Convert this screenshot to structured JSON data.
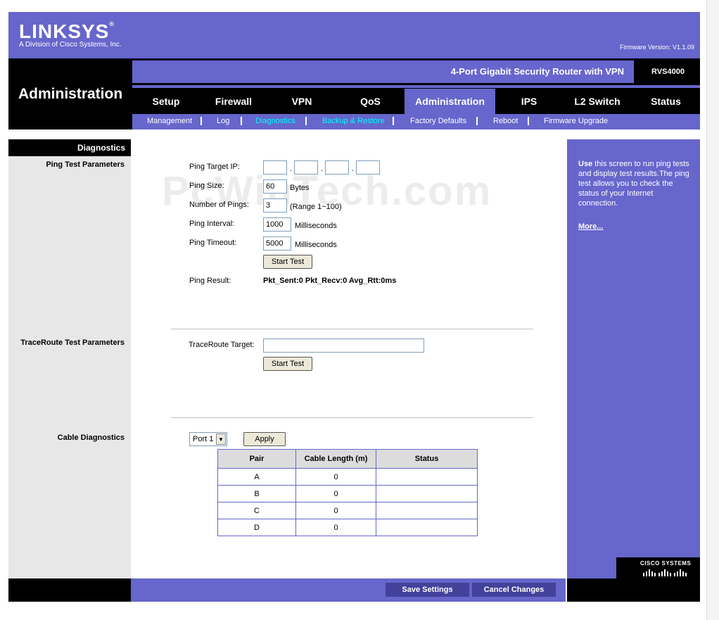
{
  "brand": {
    "logo": "LINKSYS",
    "logo_mark": "®",
    "subtitle": "A Division of Cisco Systems, Inc.",
    "firmware": "Firmware Version: V1.1.09",
    "product": "4-Port Gigabit Security Router with VPN",
    "model": "RVS4000",
    "cisco": "CISCO SYSTEMS"
  },
  "section_title": "Administration",
  "tabs": [
    {
      "label": "Setup"
    },
    {
      "label": "Firewall"
    },
    {
      "label": "VPN"
    },
    {
      "label": "QoS"
    },
    {
      "label": "Administration"
    },
    {
      "label": "IPS"
    },
    {
      "label": "L2 Switch"
    },
    {
      "label": "Status"
    }
  ],
  "subtabs": [
    {
      "label": "Management"
    },
    {
      "label": "Log"
    },
    {
      "label": "Diagnostics"
    },
    {
      "label": "Backup & Restore"
    },
    {
      "label": "Factory Defaults"
    },
    {
      "label": "Reboot"
    },
    {
      "label": "Firmware Upgrade"
    }
  ],
  "left": {
    "title": "Diagnostics",
    "ping_params": "Ping Test Parameters",
    "trace_params": "TraceRoute Test Parameters",
    "cable_diag": "Cable Diagnostics"
  },
  "ping": {
    "target_label": "Ping Target IP:",
    "octets": [
      "",
      "",
      "",
      ""
    ],
    "size_label": "Ping Size:",
    "size_value": "60",
    "size_unit": "Bytes",
    "count_label": "Number of Pings:",
    "count_value": "3",
    "count_range": "(Range 1~100)",
    "interval_label": "Ping Interval:",
    "interval_value": "1000",
    "interval_unit": "Milliseconds",
    "timeout_label": "Ping Timeout:",
    "timeout_value": "5000",
    "timeout_unit": "Milliseconds",
    "start_button": "Start Test",
    "result_label": "Ping Result:",
    "result_value": "Pkt_Sent:0 Pkt_Recv:0 Avg_Rtt:0ms"
  },
  "trace": {
    "target_label": "TraceRoute Target:",
    "target_value": "",
    "start_button": "Start Test"
  },
  "cable": {
    "port_selected": "Port 1",
    "apply_button": "Apply",
    "headers": [
      "Pair",
      "Cable Length (m)",
      "Status"
    ],
    "rows": [
      {
        "pair": "A",
        "length": "0",
        "status": ""
      },
      {
        "pair": "B",
        "length": "0",
        "status": ""
      },
      {
        "pair": "C",
        "length": "0",
        "status": ""
      },
      {
        "pair": "D",
        "length": "0",
        "status": ""
      }
    ]
  },
  "help": {
    "bold": "Use",
    "text": " this screen to run ping tests and display test results.The ping test allows you to check the status of your Internet connection.",
    "more": "More..."
  },
  "footer": {
    "save": "Save Settings",
    "cancel": "Cancel Changes"
  },
  "watermark": "PcWinTech.com",
  "colors": {
    "accent": "#6666cc",
    "current_subtab": "#00ffff",
    "dark": "#000000"
  }
}
